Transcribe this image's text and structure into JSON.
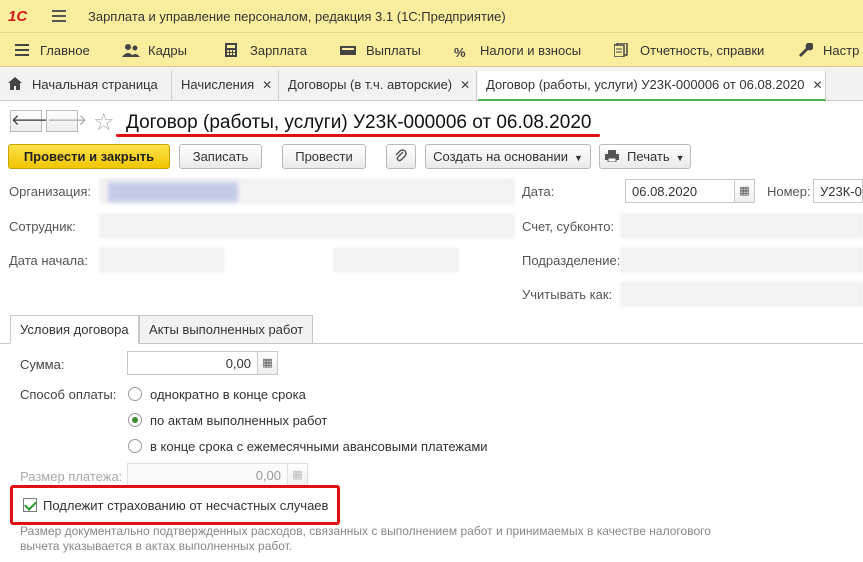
{
  "app": {
    "logo": "1С",
    "title": "Зарплата и управление персоналом, редакция 3.1  (1С:Предприятие)"
  },
  "menu": {
    "items": [
      {
        "label": "Главное",
        "icon": "menu-lines-icon"
      },
      {
        "label": "Кадры",
        "icon": "people-icon"
      },
      {
        "label": "Зарплата",
        "icon": "calculator-icon"
      },
      {
        "label": "Выплаты",
        "icon": "money-icon"
      },
      {
        "label": "Налоги и взносы",
        "icon": "percent-icon"
      },
      {
        "label": "Отчетность, справки",
        "icon": "report-icon"
      },
      {
        "label": "Настр",
        "icon": "wrench-icon"
      }
    ]
  },
  "tabs": [
    {
      "label": "Начальная страница",
      "icon": "home-icon"
    },
    {
      "label": "Начисления",
      "close": "✕"
    },
    {
      "label": "Договоры (в т.ч. авторские)",
      "close": "✕"
    },
    {
      "label": "Договор (работы, услуги) У23К-000006 от 06.08.2020",
      "close": "✕"
    }
  ],
  "header": {
    "back": "🡐",
    "forward": "🡒",
    "star": "☆",
    "title": "Договор (работы, услуги) У23К-000006 от 06.08.2020"
  },
  "toolbar": {
    "post_close": "Провести и закрыть",
    "save": "Записать",
    "post": "Провести",
    "create_based": "Создать на основании",
    "print": "Печать"
  },
  "form": {
    "org_label": "Организация:",
    "org_value": "",
    "employee_label": "Сотрудник:",
    "employee_value": "",
    "start_label": "Дата начала:",
    "start_value": "",
    "end_label": "",
    "end_value": "",
    "date_label": "Дата:",
    "date_value": "06.08.2020",
    "number_label": "Номер:",
    "number_value": "У23К-0",
    "account_label": "Счет, субконто:",
    "dept_label": "Подразделение:",
    "consider_label": "Учитывать как:"
  },
  "inner_tabs": {
    "conditions": "Условия договора",
    "acts": "Акты выполненных работ"
  },
  "conditions": {
    "sum_label": "Сумма:",
    "sum_value": "0,00",
    "payment_label": "Способ оплаты:",
    "payment_options": [
      {
        "label": "однократно в конце срока",
        "selected": false
      },
      {
        "label": "по актам выполненных работ",
        "selected": true
      },
      {
        "label": "в конце срока с ежемесячными авансовыми платежами",
        "selected": false
      }
    ],
    "payment_size_label": "Размер платежа:",
    "payment_size_value": "0,00",
    "insurance_label": "Подлежит страхованию от несчастных случаев",
    "insurance_checked": true,
    "note": "Размер документально подтвержденных расходов, связанных с выполнением работ и принимаемых в качестве налогового вычета указывается в актах выполненных работ."
  }
}
